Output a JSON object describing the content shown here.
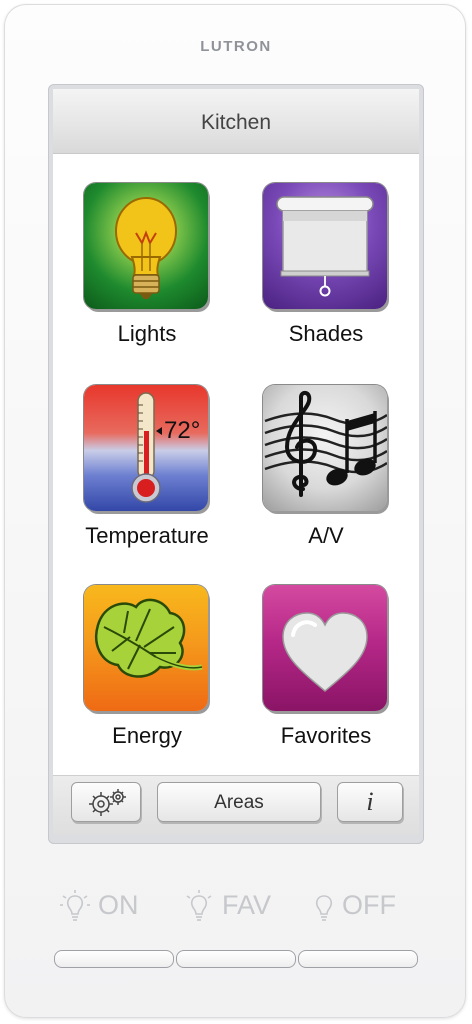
{
  "brand": "LUTRON",
  "screen": {
    "title": "Kitchen",
    "tiles": [
      {
        "label": "Lights",
        "icon": "light-bulb-icon"
      },
      {
        "label": "Shades",
        "icon": "window-shade-icon"
      },
      {
        "label": "Temperature",
        "icon": "thermometer-icon",
        "reading": "72°"
      },
      {
        "label": "A/V",
        "icon": "music-notes-icon"
      },
      {
        "label": "Energy",
        "icon": "leaf-icon"
      },
      {
        "label": "Favorites",
        "icon": "heart-icon"
      }
    ]
  },
  "bottom_bar": {
    "settings_icon": "gears-icon",
    "areas_label": "Areas",
    "info_label": "i"
  },
  "hardware_buttons": [
    {
      "label": "ON",
      "icon": "bulb-outline-icon"
    },
    {
      "label": "FAV",
      "icon": "bulb-outline-icon"
    },
    {
      "label": "OFF",
      "icon": "bulb-outline-icon"
    }
  ],
  "colors": {
    "lights_bg": "#1e8a2e",
    "shades_bg": "#5a2d97",
    "energy_bg": "#f27a1a",
    "favorites_bg": "#a0186c"
  }
}
